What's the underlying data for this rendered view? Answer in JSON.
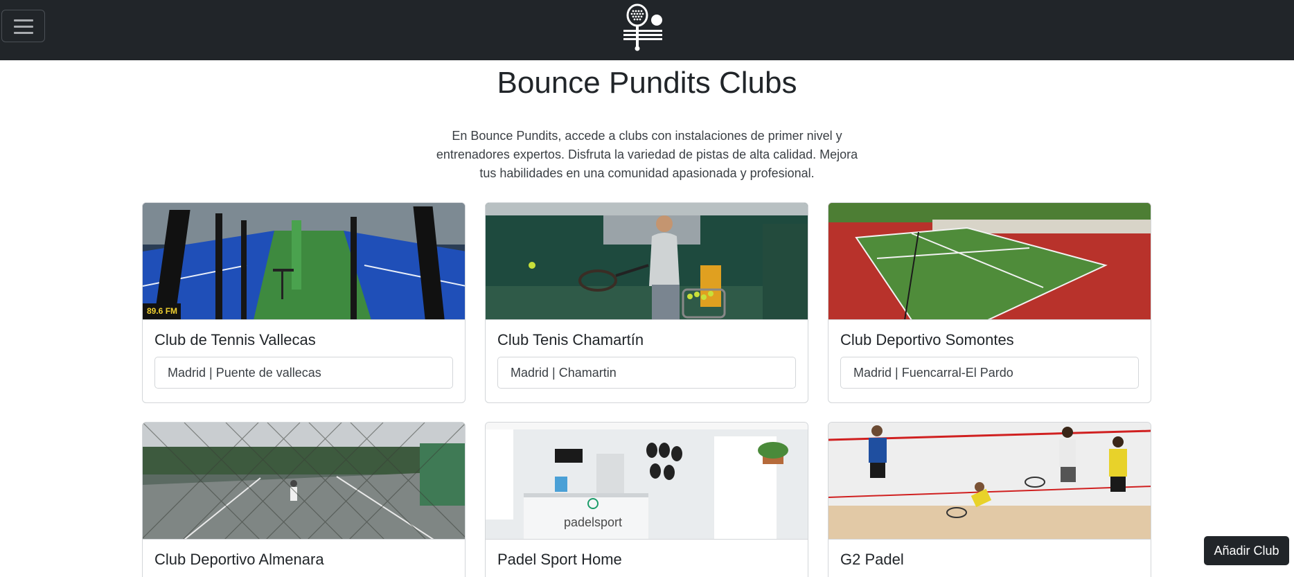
{
  "navbar": {
    "menu_icon": "hamburger-menu-icon",
    "logo_icon": "padel-racket-and-ball-logo",
    "background_color": "#212529"
  },
  "page": {
    "title": "Bounce Pundits Clubs",
    "description": "En Bounce Pundits, accede a clubs con instalaciones de primer nivel y entrenadores expertos. Disfruta la variedad de pistas de alta calidad. Mejora tus habilidades en una comunidad apasionada y profesional."
  },
  "clubs": [
    {
      "name": "Club de Tennis Vallecas",
      "location": "Madrid | Puente de vallecas",
      "image": "indoor-padel-courts-photo"
    },
    {
      "name": "Club Tenis Chamartín",
      "location": "Madrid | Chamartin",
      "image": "tennis-player-with-racket-photo"
    },
    {
      "name": "Club Deportivo Somontes",
      "location": "Madrid | Fuencarral-El Pardo",
      "image": "outdoor-tennis-court-photo"
    },
    {
      "name": "Club Deportivo Almenara",
      "location": "",
      "image": "tennis-courts-behind-fence-photo"
    },
    {
      "name": "Padel Sport Home",
      "location": "",
      "image": "padel-shop-reception-photo"
    },
    {
      "name": "G2 Padel",
      "location": "",
      "image": "squash-players-photo"
    }
  ],
  "actions": {
    "add_club_label": "Añadir Club"
  }
}
